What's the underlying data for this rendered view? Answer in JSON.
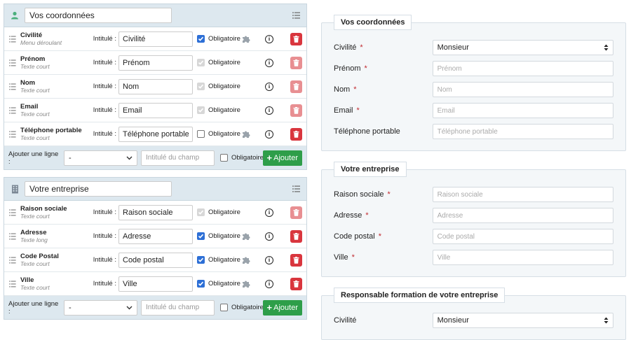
{
  "builder": {
    "intitule_label": "Intitulé :",
    "obligatoire_label": "Obligatoire",
    "add_row": {
      "label": "Ajouter une ligne :",
      "select_value": "-",
      "input_placeholder": "Intitulé du champ",
      "obligatoire": "Obligatoire",
      "button": "Ajouter"
    },
    "sections": [
      {
        "title": "Vos coordonnées",
        "icon": "user-icon",
        "fields": [
          {
            "name": "Civilité",
            "type": "Menu déroulant",
            "value": "Civilité",
            "required": "on",
            "puzzle": true,
            "delete": "active"
          },
          {
            "name": "Prénom",
            "type": "Texte court",
            "value": "Prénom",
            "required": "disabled",
            "puzzle": false,
            "delete": "dim"
          },
          {
            "name": "Nom",
            "type": "Texte court",
            "value": "Nom",
            "required": "disabled",
            "puzzle": false,
            "delete": "dim"
          },
          {
            "name": "Email",
            "type": "Texte court",
            "value": "Email",
            "required": "disabled",
            "puzzle": false,
            "delete": "dim"
          },
          {
            "name": "Téléphone portable",
            "type": "Texte court",
            "value": "Téléphone portable",
            "required": "off",
            "puzzle": true,
            "delete": "active"
          }
        ]
      },
      {
        "title": "Votre entreprise",
        "icon": "building-icon",
        "fields": [
          {
            "name": "Raison sociale",
            "type": "Texte court",
            "value": "Raison sociale",
            "required": "disabled",
            "puzzle": false,
            "delete": "dim"
          },
          {
            "name": "Adresse",
            "type": "Texte long",
            "value": "Adresse",
            "required": "on",
            "puzzle": true,
            "delete": "active"
          },
          {
            "name": "Code Postal",
            "type": "Texte court",
            "value": "Code postal",
            "required": "on",
            "puzzle": true,
            "delete": "active"
          },
          {
            "name": "Ville",
            "type": "Texte court",
            "value": "Ville",
            "required": "on",
            "puzzle": true,
            "delete": "active"
          }
        ]
      }
    ]
  },
  "preview": {
    "fieldsets": [
      {
        "legend": "Vos coordonnées",
        "rows": [
          {
            "label": "Civilité",
            "required": true,
            "kind": "select",
            "value": "Monsieur"
          },
          {
            "label": "Prénom",
            "required": true,
            "kind": "input",
            "placeholder": "Prénom"
          },
          {
            "label": "Nom",
            "required": true,
            "kind": "input",
            "placeholder": "Nom"
          },
          {
            "label": "Email",
            "required": true,
            "kind": "input",
            "placeholder": "Email"
          },
          {
            "label": "Téléphone portable",
            "required": false,
            "kind": "input",
            "placeholder": "Téléphone portable"
          }
        ]
      },
      {
        "legend": "Votre entreprise",
        "rows": [
          {
            "label": "Raison sociale",
            "required": true,
            "kind": "input",
            "placeholder": "Raison sociale"
          },
          {
            "label": "Adresse",
            "required": true,
            "kind": "input",
            "placeholder": "Adresse"
          },
          {
            "label": "Code postal",
            "required": true,
            "kind": "input",
            "placeholder": "Code postal"
          },
          {
            "label": "Ville",
            "required": true,
            "kind": "input",
            "placeholder": "Ville"
          }
        ]
      },
      {
        "legend": "Responsable formation de votre entreprise",
        "rows": [
          {
            "label": "Civilité",
            "required": false,
            "kind": "select",
            "value": "Monsieur"
          }
        ]
      }
    ],
    "required_mark": "*"
  },
  "colors": {
    "accent_green": "#2e9e49",
    "delete_red": "#d9363e",
    "required_red": "#c0272d",
    "header_bg": "#dde8ef"
  }
}
